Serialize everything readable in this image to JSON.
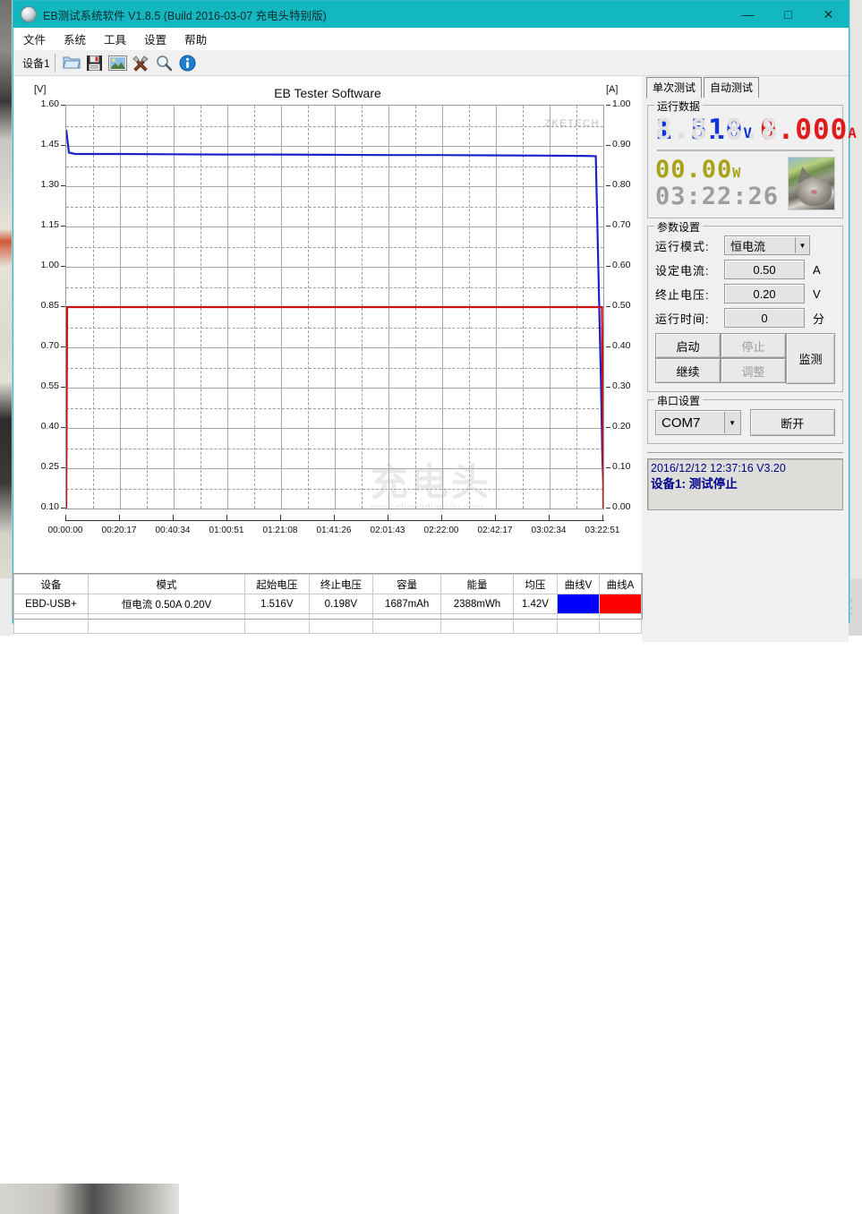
{
  "window": {
    "title": "EB测试系统软件 V1.8.5 (Build 2016-03-07 充电头特别版)",
    "minimize": "—",
    "maximize": "□",
    "close": "✕"
  },
  "menu": [
    "文件",
    "系统",
    "工具",
    "设置",
    "帮助"
  ],
  "toolbar": {
    "device_tab": "设备1",
    "icons": [
      "folder-open-icon",
      "save-icon",
      "image-icon",
      "tools-icon",
      "search-icon",
      "info-icon"
    ]
  },
  "chart": {
    "title": "EB Tester Software",
    "left_axis_label": "[V]",
    "right_axis_label": "[A]",
    "watermark_brand": "ZKETECH",
    "watermark_cn": "充电头",
    "watermark_url": "www.chongdiantou.com"
  },
  "chart_data": {
    "type": "line",
    "title": "EB Tester Software",
    "xlabel": "",
    "ylabel": "[V]",
    "y2label": "[A]",
    "grid": true,
    "legend": "none",
    "x_ticks": [
      "00:00:00",
      "00:20:17",
      "00:40:34",
      "01:00:51",
      "01:21:08",
      "01:41:26",
      "02:01:43",
      "02:22:00",
      "02:42:17",
      "03:02:34",
      "03:22:51"
    ],
    "xlim": [
      0,
      12171
    ],
    "ylim": [
      0.1,
      1.6
    ],
    "y_ticks": [
      "0.10",
      "0.25",
      "0.40",
      "0.55",
      "0.70",
      "0.85",
      "1.00",
      "1.15",
      "1.30",
      "1.45",
      "1.60"
    ],
    "y2lim": [
      0.0,
      1.0
    ],
    "y2_ticks": [
      "0.00",
      "0.10",
      "0.20",
      "0.30",
      "0.40",
      "0.50",
      "0.60",
      "0.70",
      "0.80",
      "0.90",
      "1.00"
    ],
    "series": [
      {
        "name": "曲线V",
        "axis": "left",
        "color": "#1a23c8",
        "unit": "V",
        "x": [
          0,
          60,
          200,
          600,
          1200,
          2400,
          3600,
          4800,
          6000,
          7200,
          8400,
          9600,
          10800,
          11700,
          12000,
          12120,
          12150,
          12171
        ],
        "values": [
          1.51,
          1.425,
          1.42,
          1.42,
          1.42,
          1.419,
          1.418,
          1.418,
          1.417,
          1.416,
          1.416,
          1.415,
          1.414,
          1.413,
          1.412,
          0.55,
          0.28,
          0.198
        ]
      },
      {
        "name": "曲线A",
        "axis": "right",
        "color": "#cc1111",
        "unit": "A",
        "x": [
          0,
          20,
          60,
          1200,
          3600,
          6000,
          9600,
          11700,
          12140,
          12160,
          12171
        ],
        "values": [
          0.0,
          0.5,
          0.5,
          0.5,
          0.5,
          0.5,
          0.5,
          0.5,
          0.5,
          0.25,
          0.0
        ]
      }
    ]
  },
  "right_panel": {
    "tabs": [
      {
        "label": "单次测试",
        "active": true
      },
      {
        "label": "自动测试",
        "active": false
      }
    ],
    "run_data": {
      "caption": "运行数据",
      "voltage": "1.510",
      "voltage_ghost": "8.8.8.8",
      "voltage_unit": "V",
      "current": "0.000",
      "current_unit": "A",
      "power": "00.00",
      "power_unit": "W",
      "elapsed": "03:22:26",
      "photo": "cat-photo"
    },
    "params": {
      "caption": "参数设置",
      "mode_label": "运行模式:",
      "mode_value": "恒电流",
      "current_label": "设定电流:",
      "current_value": "0.50",
      "current_unit": "A",
      "cutoff_label": "终止电压:",
      "cutoff_value": "0.20",
      "cutoff_unit": "V",
      "runtime_label": "运行时间:",
      "runtime_value": "0",
      "runtime_unit": "分",
      "buttons": {
        "start": "启动",
        "stop": "停止",
        "continue": "继续",
        "adjust": "调整",
        "monitor": "监测"
      }
    },
    "serial": {
      "caption": "串口设置",
      "port": "COM7",
      "action": "断开"
    },
    "log": {
      "line1": "2016/12/12 12:37:16  V3.20",
      "line2": "设备1: 测试停止"
    }
  },
  "table": {
    "headers": [
      "设备",
      "模式",
      "起始电压",
      "终止电压",
      "容量",
      "能量",
      "均压",
      "曲线V",
      "曲线A"
    ],
    "rows": [
      {
        "设备": "EBD-USB+",
        "模式": "恒电流  0.50A  0.20V",
        "起始电压": "1.516V",
        "终止电压": "0.198V",
        "容量": "1687mAh",
        "能量": "2388mWh",
        "均压": "1.42V",
        "曲线V": "",
        "曲线A": ""
      }
    ],
    "curve_v_color": "#0000ff",
    "curve_a_color": "#ff0000"
  },
  "desktop": {
    "site_watermark": "什么值得买",
    "site_logo": "值"
  }
}
